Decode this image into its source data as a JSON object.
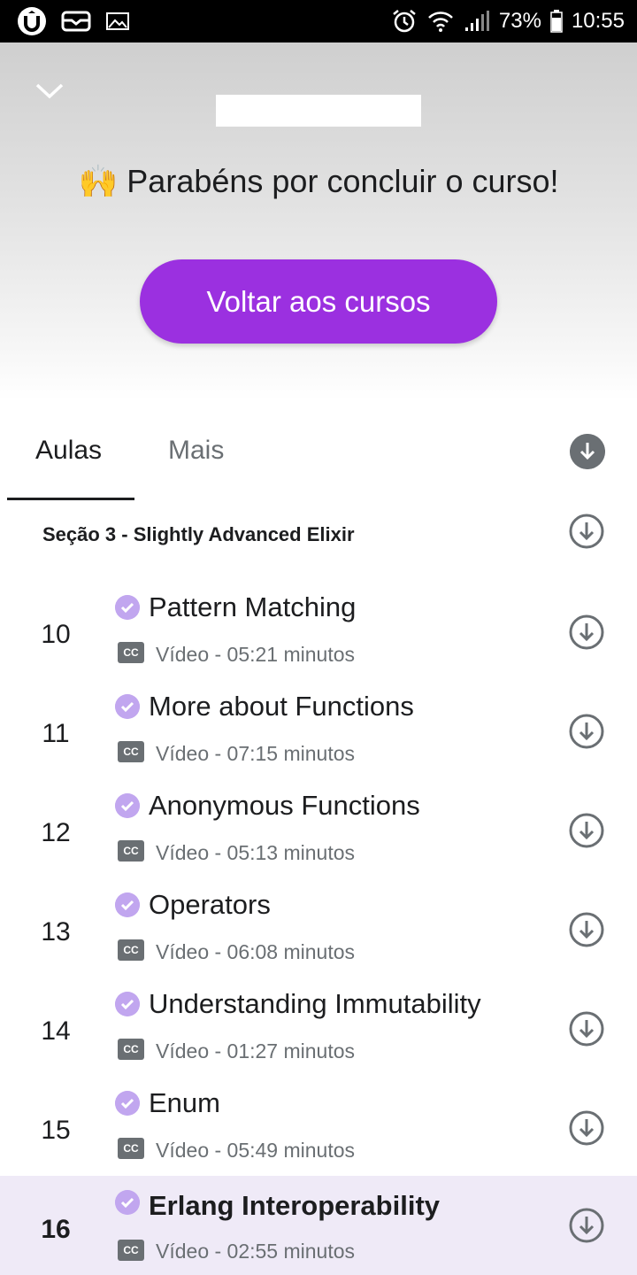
{
  "status_bar": {
    "battery": "73%",
    "time": "10:55",
    "icons": [
      "udemy-icon",
      "mail-icon",
      "image-icon",
      "alarm-icon",
      "wifi-icon",
      "signal-icon",
      "battery-icon"
    ]
  },
  "header": {
    "collapse_icon": "chevron-down-icon",
    "congrats_emoji": "🙌",
    "congrats_text": "Parabéns por concluir o curso!",
    "back_button": "Voltar aos cursos",
    "accent_color": "#9b30e0"
  },
  "tabs": [
    {
      "label": "Aulas",
      "selected": true
    },
    {
      "label": "Mais",
      "selected": false
    }
  ],
  "section": {
    "title": "Seção 3 - Slightly Advanced Elixir"
  },
  "lectures": [
    {
      "number": "10",
      "title": "Pattern Matching",
      "cc": "CC",
      "meta": "Vídeo - 05:21 minutos",
      "completed": true
    },
    {
      "number": "11",
      "title": "More about Functions",
      "cc": "CC",
      "meta": "Vídeo - 07:15 minutos",
      "completed": true
    },
    {
      "number": "12",
      "title": "Anonymous Functions",
      "cc": "CC",
      "meta": "Vídeo - 05:13 minutos",
      "completed": true
    },
    {
      "number": "13",
      "title": "Operators",
      "cc": "CC",
      "meta": "Vídeo - 06:08 minutos",
      "completed": true
    },
    {
      "number": "14",
      "title": "Understanding Immutability",
      "cc": "CC",
      "meta": "Vídeo - 01:27 minutos",
      "completed": true
    },
    {
      "number": "15",
      "title": "Enum",
      "cc": "CC",
      "meta": "Vídeo - 05:49 minutos",
      "completed": true
    },
    {
      "number": "16",
      "title": "Erlang Interoperability",
      "cc": "CC",
      "meta": "Vídeo - 02:55 minutos",
      "completed": true,
      "current": true
    }
  ]
}
